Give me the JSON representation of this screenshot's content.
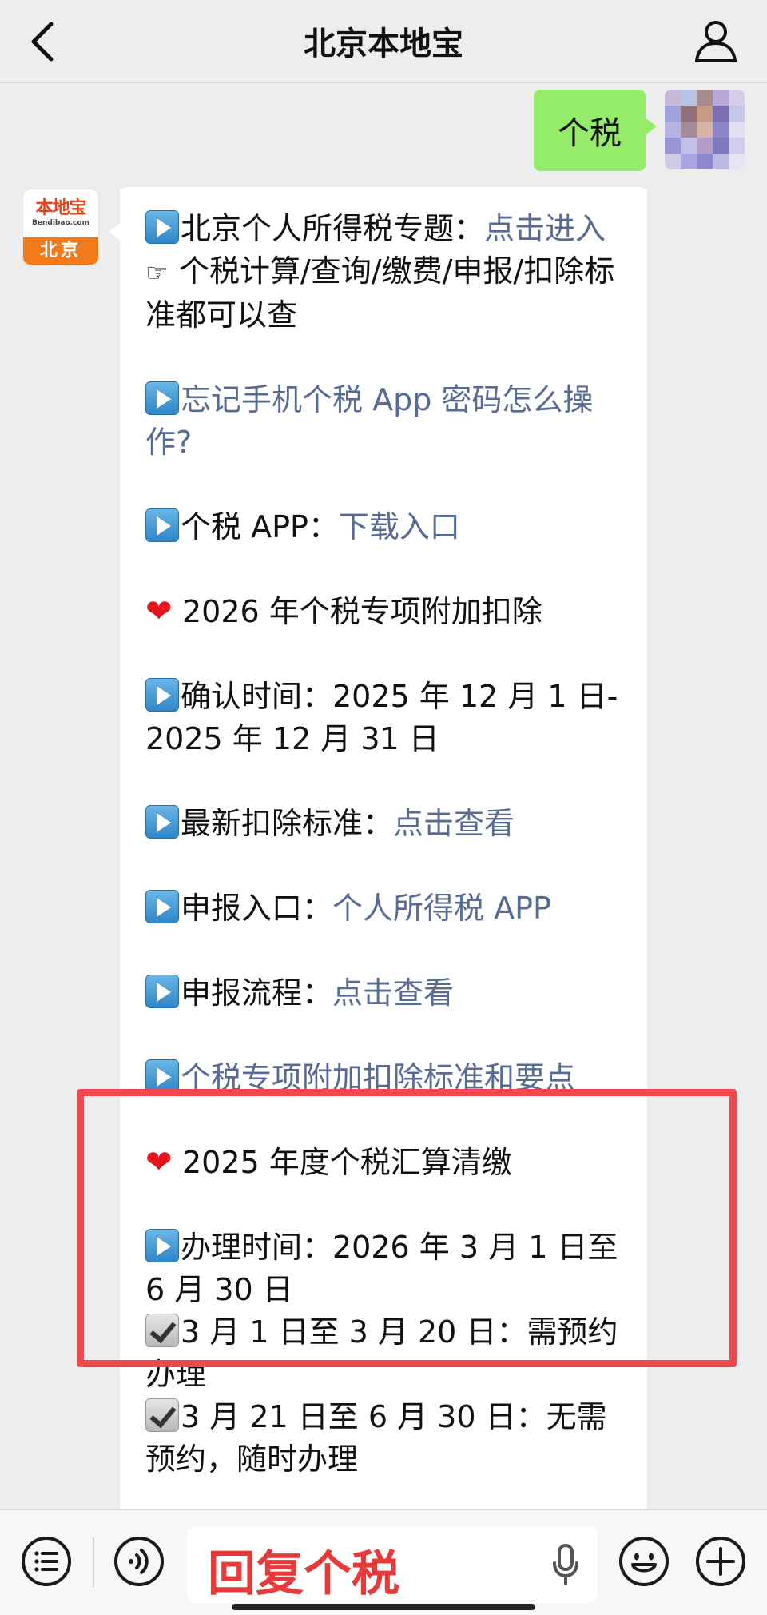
{
  "header": {
    "title": "北京本地宝",
    "back_icon": "back-arrow-icon",
    "profile_icon": "person-icon"
  },
  "outgoing_message": {
    "text": "个税"
  },
  "sender_avatar": {
    "brand": "本地宝",
    "site": "Bendibao.com",
    "city": "北京"
  },
  "message": {
    "l1_text": "北京个人所得税专题：",
    "l1_link": "点击进入",
    "l2": "个税计算/查询/缴费/申报/扣除标准都可以查",
    "l3_link": "忘记手机个税 App 密码怎么操作?",
    "l4_text": "个税 APP：",
    "l4_link": "下载入口",
    "l5": "2026 年个税专项附加扣除",
    "l6": "确认时间：2025 年 12 月 1 日-2025 年 12 月 31 日",
    "l7_text": "最新扣除标准：",
    "l7_link": "点击查看",
    "l8_text": "申报入口：",
    "l8_link": "个人所得税 APP",
    "l9_text": "申报流程：",
    "l9_link": "点击查看",
    "l10_link": "个税专项附加扣除标准和要点",
    "l11": "2025 年度个税汇算清缴",
    "l12": "办理时间：2026 年 3 月 1 日至 6 月 30 日",
    "l13": "3 月 1 日至 3 月 20 日：需预约办理",
    "l14": "3 月 21 日至 6 月 30 日：无需预约，随时办理"
  },
  "input_bar": {
    "value": "回复个税",
    "menu_icon": "list-menu-icon",
    "voice_icon": "voice-icon",
    "mic_icon": "microphone-icon",
    "emoji_icon": "emoji-icon",
    "plus_icon": "plus-icon"
  },
  "colors": {
    "link": "#576b95",
    "outgoing_bubble": "#95ec69",
    "highlight_frame": "#f2474d",
    "input_text": "#e83a3a"
  }
}
